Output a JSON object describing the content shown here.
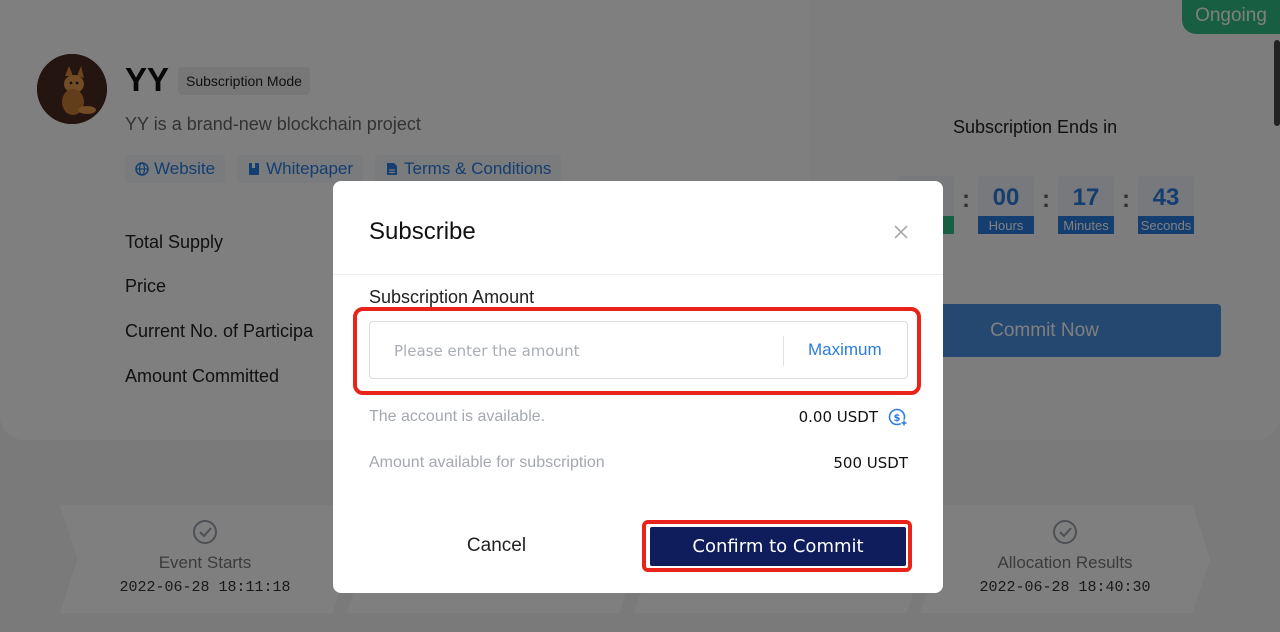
{
  "status": "Ongoing",
  "project": {
    "name": "YY",
    "mode": "Subscription Mode",
    "description": "YY is a brand-new blockchain project",
    "links": [
      "Website",
      "Whitepaper",
      "Terms & Conditions"
    ],
    "info_labels": [
      "Total Supply",
      "Price",
      "Current No. of Participa",
      "Amount Committed"
    ]
  },
  "countdown": {
    "title": "Subscription Ends in",
    "hours": "00",
    "hours_label": "Hours",
    "minutes": "17",
    "minutes_label": "Minutes",
    "seconds": "43",
    "seconds_label": "Seconds"
  },
  "commit_now_label": "Commit Now",
  "timeline": {
    "steps": [
      {
        "title": "Event Starts",
        "time": "2022-06-28 18:11:18"
      },
      {
        "title": "Allocation Results",
        "time": "2022-06-28 18:40:30"
      }
    ]
  },
  "modal": {
    "title": "Subscribe",
    "amount_label": "Subscription Amount",
    "amount_placeholder": "Please enter the amount",
    "amount_value": "",
    "max_label": "Maximum",
    "account_label": "The account is available.",
    "account_value": "0.00 USDT",
    "available_label": "Amount available for subscription",
    "available_value": "500 USDT",
    "cancel_label": "Cancel",
    "confirm_label": "Confirm to Commit"
  },
  "colors": {
    "accent": "#2a7de1",
    "status_green": "#2ebd85",
    "confirm_navy": "#0f1d5c",
    "highlight_red": "#e8231a"
  },
  "icons": [
    "fox-avatar",
    "globe-icon",
    "document-icon",
    "file-icon",
    "close-icon",
    "dollar-plus-icon",
    "check-circle-icon"
  ]
}
